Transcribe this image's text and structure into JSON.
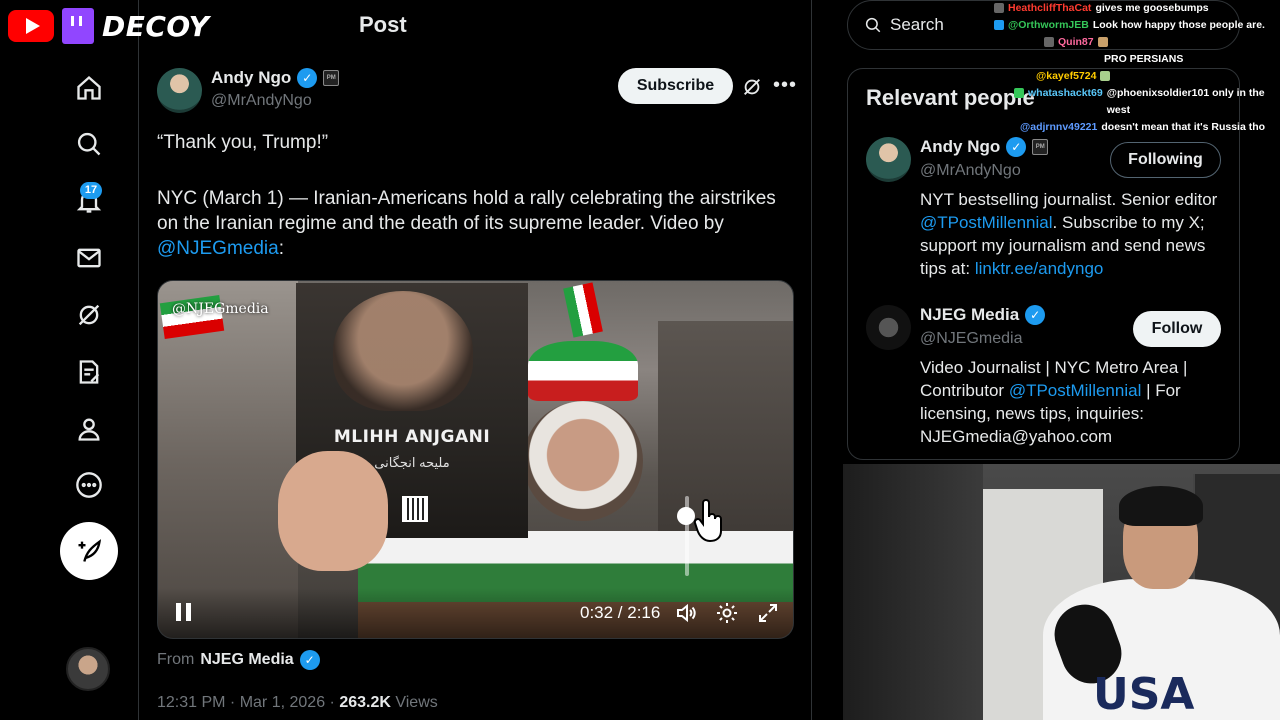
{
  "brand": {
    "name": "DECOY"
  },
  "header": {
    "title": "Post"
  },
  "sidebar": {
    "notifications_count": "17"
  },
  "post": {
    "author_name": "Andy Ngo",
    "author_handle": "@MrAndyNgo",
    "pm_badge": "PM",
    "subscribe_label": "Subscribe",
    "quote": "“Thank you, Trump!”",
    "body_text": "NYC (March 1) — Iranian-Americans hold a rally celebrating the airstrikes on the Iranian regime and the death of its supreme leader. Video by ",
    "body_mention": "@NJEGmedia",
    "body_tail": ":",
    "video": {
      "watermark": "@NJEGmedia",
      "book_title": "MLIHH ANJGANI",
      "book_subtitle": "ملیحه انجگانی",
      "current_time": "0:32",
      "duration": "2:16",
      "time_display": "0:32 / 2:16",
      "volume_level": 0.75
    },
    "from_label": "From",
    "from_name": "NJEG Media",
    "timestamp": "12:31 PM · Mar 1, 2026 · ",
    "views_count": "263.2K",
    "views_label": "Views"
  },
  "search": {
    "placeholder": "Search"
  },
  "chat": [
    {
      "user": "HeathcliffThaCat",
      "color": "#ff3b30",
      "message": "gives me goosebumps"
    },
    {
      "user": "@OrthwormJEB",
      "color": "#35c759",
      "message": "Look how happy those people are."
    },
    {
      "user": "Quin87",
      "color": "#ff6a9e",
      "message": ""
    },
    {
      "user": "",
      "color": "#ffffff",
      "message": "PRO PERSIANS"
    },
    {
      "user": "@kayef5724",
      "color": "#ffcc00",
      "message": ""
    },
    {
      "user": "whatashackt69",
      "color": "#5ac8fa",
      "message": "@phoenixsoldier101 only in the west"
    },
    {
      "user": "@adjrnnv49221",
      "color": "#5e9bff",
      "message": "doesn't mean that it's Russia tho"
    }
  ],
  "relevant_people": {
    "title": "Relevant people",
    "people": [
      {
        "name": "Andy Ngo",
        "handle": "@MrAndyNgo",
        "button": "Following",
        "bio_pre": "NYT bestselling journalist. Senior editor ",
        "bio_mention": "@TPostMillennial",
        "bio_mid": ". Subscribe to my X; support my journalism and send news tips at: ",
        "bio_link": "linktr.ee/andyngo"
      },
      {
        "name": "NJEG Media",
        "handle": "@NJEGmedia",
        "button": "Follow",
        "bio_pre": "Video Journalist | NYC Metro Area | Contributor ",
        "bio_mention": "@TPostMillennial",
        "bio_mid": " | For licensing, news tips, inquiries: NJEGmedia@yahoo.com",
        "bio_link": ""
      }
    ]
  },
  "webcam": {
    "shirt_text": "USA"
  },
  "colors": {
    "accent": "#1d9bf0",
    "background": "#000000",
    "muted": "#71767b"
  }
}
